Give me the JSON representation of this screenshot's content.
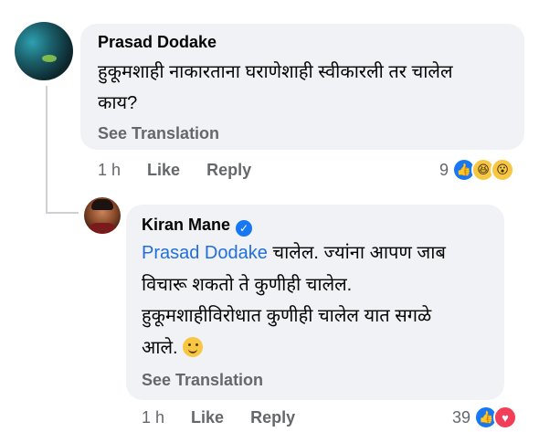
{
  "comment": {
    "author": "Prasad Dodake",
    "text_line1": "हुकूमशाही नाकारताना घराणेशाही स्वीकारली तर चालेल",
    "text_line2": "काय?",
    "see_translation": "See Translation",
    "time": "1 h",
    "like": "Like",
    "reply": "Reply",
    "reaction_count": "9",
    "reactions": [
      "like-icon",
      "haha-icon",
      "wow-icon"
    ]
  },
  "reply": {
    "author": "Kiran Mane",
    "verified": true,
    "mention": "Prasad Dodake",
    "text_line1_rest": " चालेल. ज्यांना आपण जाब",
    "text_line2": "विचारू शकतो ते कुणीही चालेल.",
    "text_line3": "हुकूमशाहीविरोधात कुणीही चालेल यात सगळे",
    "text_line4": "आले.",
    "emoji": "smile-emoji",
    "see_translation": "See Translation",
    "time": "1 h",
    "like": "Like",
    "reply": "Reply",
    "reaction_count": "39",
    "reactions": [
      "like-icon",
      "love-icon"
    ]
  },
  "colors": {
    "bubble": "#f0f2f5",
    "mention": "#216fdb",
    "muted": "#65676b",
    "like_blue": "#1877f2",
    "love_red": "#f33e58"
  }
}
